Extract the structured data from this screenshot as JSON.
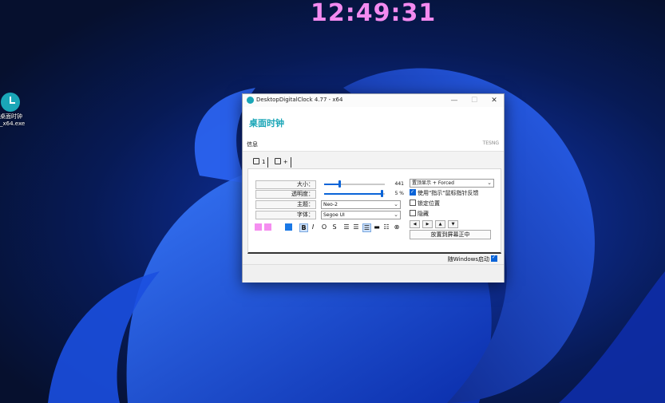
{
  "desktop": {
    "clock_time": "12:49:31",
    "icon": {
      "label_line1": "桌面时钟",
      "label_line2": "_x64.exe"
    }
  },
  "window": {
    "title": "DesktopDigitalClock 4.77 - x64",
    "controls": {
      "minimize": "—",
      "maximize": "☐",
      "close": "✕"
    },
    "app_name": "桌面时钟",
    "brand": "TESNG",
    "section_label": "信息",
    "tabs": [
      {
        "label": "1"
      },
      {
        "label": "+"
      }
    ],
    "rows": {
      "size": {
        "label": "大小：",
        "value": "441",
        "level": 0.25
      },
      "opacity": {
        "label": "透明度：",
        "value": "5 %",
        "level": 0.95
      },
      "theme": {
        "label": "主题：",
        "value": "Neo-2"
      },
      "font": {
        "label": "字体：",
        "value": "Segoe UI"
      }
    },
    "swatch_colors": [
      "#f58ef0",
      "#f58ef0",
      "#ffffff",
      "#1a78e6"
    ],
    "format_buttons": [
      "B",
      "I",
      "O",
      "S"
    ],
    "align_icons": [
      "align-left-icon",
      "align-center-icon",
      "align-right-icon",
      "shadow-icon",
      "effect-icon",
      "reset-icon"
    ],
    "topmost_select": "置顶显示 + Forced",
    "checks": {
      "use_indicator": "使用\"指示\"鼠标指针反馈",
      "lock_position": "锁定位置",
      "hide": "隐藏"
    },
    "arrows": [
      "◀",
      "▶",
      "▲",
      "▼"
    ],
    "center_button": "放置到屏幕正中",
    "autostart_label": "随Windows启动"
  }
}
